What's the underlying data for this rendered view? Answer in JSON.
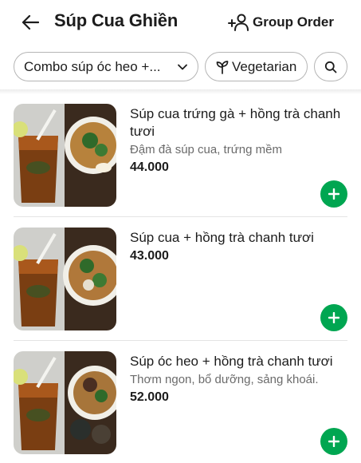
{
  "header": {
    "back_icon": "arrow-left-icon",
    "title": "Súp Cua Ghiền",
    "group_order_label": "Group Order",
    "group_order_icon": "users-plus-icon"
  },
  "filters": {
    "combo_label": "Combo súp óc heo +...",
    "combo_icon": "chevron-down-icon",
    "vegetarian_label": "Vegetarian",
    "vegetarian_icon": "sprout-icon",
    "search_icon": "search-icon"
  },
  "items": [
    {
      "name": "Súp cua trứng gà + hồng trà chanh tươi",
      "desc": "Đậm đà súp cua, trứng mềm",
      "price": "44.000"
    },
    {
      "name": "Súp cua + hồng trà chanh tươi",
      "desc": "",
      "price": "43.000"
    },
    {
      "name": "Súp óc heo + hồng trà chanh tươi",
      "desc": "Thơm ngon, bổ dưỡng, sảng khoái.",
      "price": "52.000"
    }
  ],
  "colors": {
    "accent": "#00a651",
    "text": "#1c1c1c",
    "muted": "#6b6b6b",
    "border": "#b5b5b5"
  }
}
